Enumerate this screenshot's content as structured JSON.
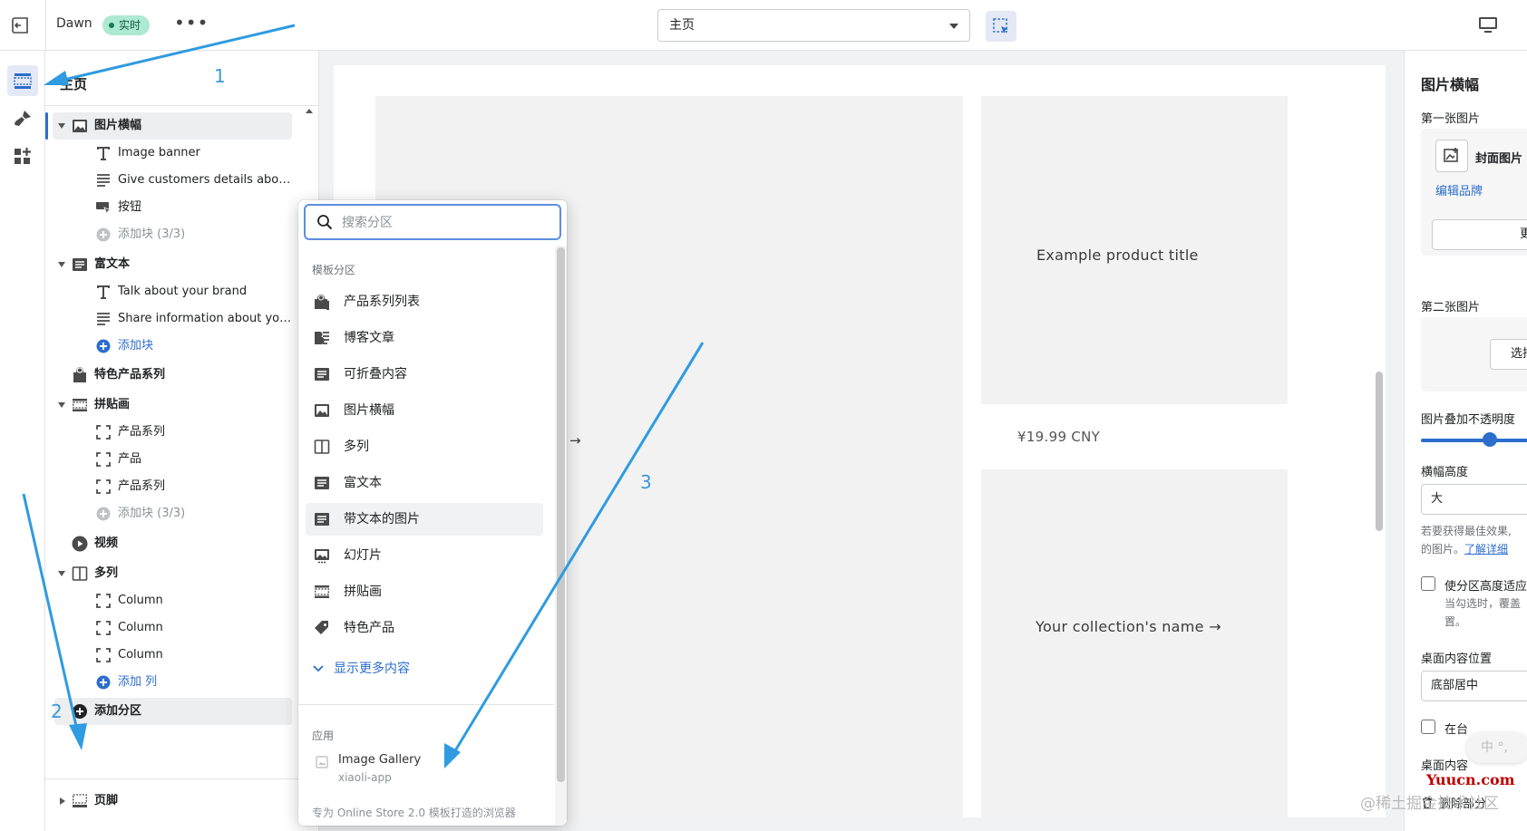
{
  "topbar": {
    "theme_name": "Dawn",
    "live_badge": "实时",
    "more_label": "•••",
    "page_select_value": "主页"
  },
  "sidebar": {
    "title": "主页",
    "sections": [
      {
        "label": "图片横幅",
        "blocks": [
          "Image banner",
          "Give customers details abo…",
          "按钮"
        ],
        "add_label": "添加块 (3/3)"
      },
      {
        "label": "富文本",
        "blocks": [
          "Talk about your brand",
          "Share information about yo…"
        ],
        "add_label": "添加块"
      },
      {
        "label": "特色产品系列"
      },
      {
        "label": "拼贴画",
        "blocks": [
          "产品系列",
          "产品",
          "产品系列"
        ],
        "add_label": "添加块 (3/3)"
      },
      {
        "label": "视频"
      },
      {
        "label": "多列",
        "blocks": [
          "Column",
          "Column",
          "Column"
        ],
        "add_label": "添加 列"
      }
    ],
    "add_section_label": "添加分区",
    "footer_label": "页脚"
  },
  "preview": {
    "product_title": "Example product title",
    "price": "¥19.99 CNY",
    "collection_name": "Your collection's name",
    "arrow": "→"
  },
  "popover": {
    "search_placeholder": "搜索分区",
    "group_template": "模板分区",
    "items": [
      {
        "label": "产品系列列表",
        "icon": "collection-list-icon"
      },
      {
        "label": "博客文章",
        "icon": "blog-icon"
      },
      {
        "label": "可折叠内容",
        "icon": "collapsible-icon"
      },
      {
        "label": "图片横幅",
        "icon": "image-icon"
      },
      {
        "label": "多列",
        "icon": "columns-icon"
      },
      {
        "label": "富文本",
        "icon": "text-icon"
      },
      {
        "label": "带文本的图片",
        "icon": "image-with-text-icon"
      },
      {
        "label": "幻灯片",
        "icon": "slideshow-icon"
      },
      {
        "label": "拼贴画",
        "icon": "collage-icon"
      },
      {
        "label": "特色产品",
        "icon": "tag-icon"
      }
    ],
    "show_more": "显示更多内容",
    "group_apps": "应用",
    "app": {
      "name": "Image Gallery",
      "developer": "xiaoli-app"
    },
    "footer_note": "专为 Online Store 2.0 模板打造的浏览器"
  },
  "settings": {
    "title": "图片横幅",
    "first_image_label": "第一张图片",
    "cover_image_label": "封面图片",
    "edit_brand_link": "编辑品牌",
    "change_button": "更",
    "second_image_label": "第二张图片",
    "select_button": "选择",
    "overlay_label": "图片叠加不透明度",
    "overlay_value": 0.55,
    "height_label": "横幅高度",
    "height_value": "大",
    "help_line1": "若要获得最佳效果,",
    "help_line2": "的图片。",
    "learn_more_link": "了解详细",
    "adapt_height_label": "使分区高度适应",
    "adapt_help_1": "当勾选时，覆盖",
    "adapt_help_2": "置。",
    "desktop_position_label": "桌面内容位置",
    "desktop_position_value": "底部居中",
    "show_container_label": "在台",
    "desktop_alignment_label": "桌面内容",
    "delete_label": "删除部分"
  },
  "annotations": {
    "step1": "1",
    "step2": "2",
    "step3": "3",
    "ime_text": "中 °,",
    "watermark_site": "Yuucn.com",
    "watermark_credit": "@稀土掘金技术社区"
  },
  "colors": {
    "accent": "#2c6ecb",
    "arrow": "#2f9be0",
    "live_badge_bg": "#aee9d1"
  }
}
